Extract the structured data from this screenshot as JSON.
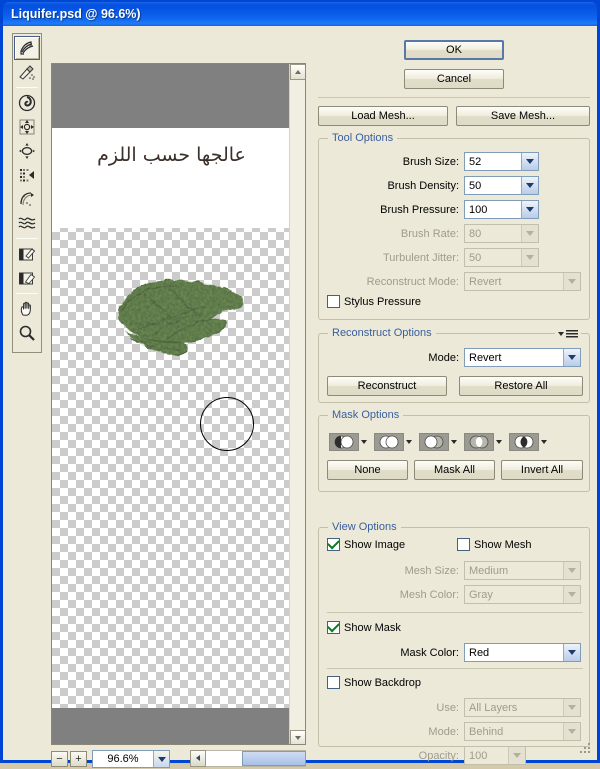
{
  "window": {
    "title": "Liquifer.psd @ 96.6%)"
  },
  "toolbar": {
    "tools": [
      {
        "name": "forward-warp-tool",
        "label": "Forward Warp Tool",
        "selected": true
      },
      {
        "name": "reconstruct-tool",
        "label": "Reconstruct Tool",
        "selected": false
      },
      {
        "name": "twirl-clockwise-tool",
        "label": "Twirl Clockwise Tool",
        "selected": false
      },
      {
        "name": "pucker-tool",
        "label": "Pucker Tool",
        "selected": false
      },
      {
        "name": "bloat-tool",
        "label": "Bloat Tool",
        "selected": false
      },
      {
        "name": "push-left-tool",
        "label": "Push Left Tool",
        "selected": false
      },
      {
        "name": "mirror-tool",
        "label": "Mirror Tool",
        "selected": false
      },
      {
        "name": "turbulence-tool",
        "label": "Turbulence Tool",
        "selected": false
      },
      {
        "name": "freeze-mask-tool",
        "label": "Freeze Mask Tool",
        "selected": false
      },
      {
        "name": "thaw-mask-tool",
        "label": "Thaw Mask Tool",
        "selected": false
      },
      {
        "name": "hand-tool",
        "label": "Hand Tool",
        "selected": false
      },
      {
        "name": "zoom-tool",
        "label": "Zoom Tool",
        "selected": false
      }
    ]
  },
  "canvas": {
    "artwork_text": "عالجها حسب اللزم",
    "leaf_color": "#4e6b38",
    "leaf_shadow_color": "#354924",
    "checker_light": "#ffffff",
    "checker_dark": "#cccccc",
    "band_color": "#808080",
    "brush_cursor_label": "brush-cursor"
  },
  "zoombar": {
    "zoom_out_label": "−",
    "zoom_in_label": "+",
    "zoom_value": "96.6%"
  },
  "actions": {
    "ok": "OK",
    "cancel": "Cancel",
    "load_mesh": "Load Mesh...",
    "save_mesh": "Save Mesh..."
  },
  "tool_options": {
    "title": "Tool Options",
    "fields": [
      {
        "name": "brush-size",
        "label": "Brush Size:",
        "value": "52",
        "disabled": false
      },
      {
        "name": "brush-density",
        "label": "Brush Density:",
        "value": "50",
        "disabled": false
      },
      {
        "name": "brush-pressure",
        "label": "Brush Pressure:",
        "value": "100",
        "disabled": false
      },
      {
        "name": "brush-rate",
        "label": "Brush Rate:",
        "value": "80",
        "disabled": true
      },
      {
        "name": "turbulent-jitter",
        "label": "Turbulent Jitter:",
        "value": "50",
        "disabled": true
      },
      {
        "name": "reconstruct-mode",
        "label": "Reconstruct Mode:",
        "value": "Revert",
        "disabled": true
      }
    ],
    "stylus_pressure": {
      "label": "Stylus Pressure",
      "checked": false
    }
  },
  "reconstruct_options": {
    "title": "Reconstruct Options",
    "mode_label": "Mode:",
    "mode_value": "Revert",
    "reconstruct_button": "Reconstruct",
    "restore_all_button": "Restore All"
  },
  "mask_options": {
    "title": "Mask Options",
    "icons": [
      {
        "name": "mask-replace-selection-icon"
      },
      {
        "name": "mask-add-to-selection-icon"
      },
      {
        "name": "mask-subtract-from-selection-icon"
      },
      {
        "name": "mask-intersect-with-selection-icon"
      },
      {
        "name": "mask-invert-selection-icon"
      }
    ],
    "none_button": "None",
    "mask_all_button": "Mask All",
    "invert_all_button": "Invert All"
  },
  "view_options": {
    "title": "View Options",
    "show_image": {
      "label": "Show Image",
      "checked": true
    },
    "show_mesh": {
      "label": "Show Mesh",
      "checked": false
    },
    "mesh_size": {
      "label": "Mesh Size:",
      "value": "Medium",
      "disabled": true
    },
    "mesh_color": {
      "label": "Mesh Color:",
      "value": "Gray",
      "disabled": true
    },
    "show_mask": {
      "label": "Show Mask",
      "checked": true
    },
    "mask_color": {
      "label": "Mask Color:",
      "value": "Red",
      "disabled": false
    },
    "show_backdrop": {
      "label": "Show Backdrop",
      "checked": false
    },
    "use": {
      "label": "Use:",
      "value": "All Layers",
      "disabled": true
    },
    "mode": {
      "label": "Mode:",
      "value": "Behind",
      "disabled": true
    },
    "opacity": {
      "label": "Opacity:",
      "value": "100",
      "disabled": true
    }
  }
}
